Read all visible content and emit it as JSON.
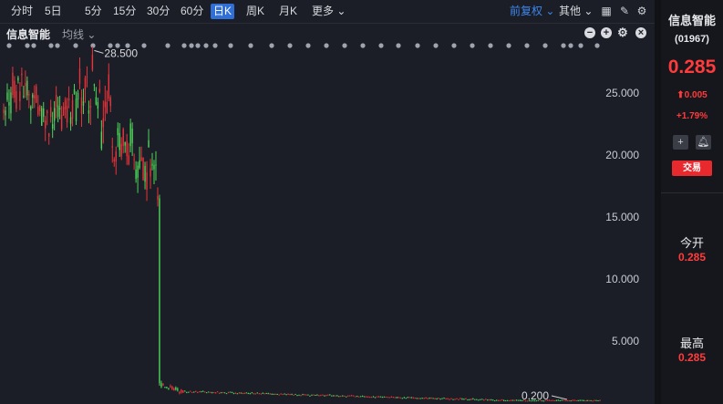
{
  "toolbar": {
    "timeframes": [
      "分时",
      "5日",
      "5分",
      "15分",
      "30分",
      "60分",
      "日K",
      "周K",
      "月K",
      "更多 ⌄"
    ],
    "active_index": 6,
    "adjust_label": "前复权 ⌄",
    "other_label": "其他 ⌄"
  },
  "subbar": {
    "stock_name": "信息智能",
    "ma_label": "均线 ⌄"
  },
  "chart_data": {
    "type": "candlestick",
    "y_ticks": [
      "25.000",
      "20.000",
      "15.000",
      "10.000",
      "5.000"
    ],
    "ylim": [
      0,
      28.5
    ],
    "high_annotation": "28.500",
    "low_annotation": "0.200",
    "segments": [
      {
        "phase": "plateau",
        "from": "start",
        "price_range": [
          21.5,
          28.5
        ]
      },
      {
        "phase": "decline",
        "price_range": [
          16.5,
          21.5
        ]
      },
      {
        "phase": "crash",
        "from": 16.5,
        "to": 1.6
      },
      {
        "phase": "tail",
        "from": 1.6,
        "to": 0.2
      }
    ],
    "up_color": "#e8333a",
    "down_color": "#4fd35a"
  },
  "side": {
    "name": "信息智能",
    "code": "(01967)",
    "price": "0.285",
    "change": "⬆0.005",
    "change_pct": "+1.79%",
    "trade_label": "交易",
    "open_label": "今开",
    "open_value": "0.285",
    "high_label": "最高",
    "high_value": "0.285"
  }
}
